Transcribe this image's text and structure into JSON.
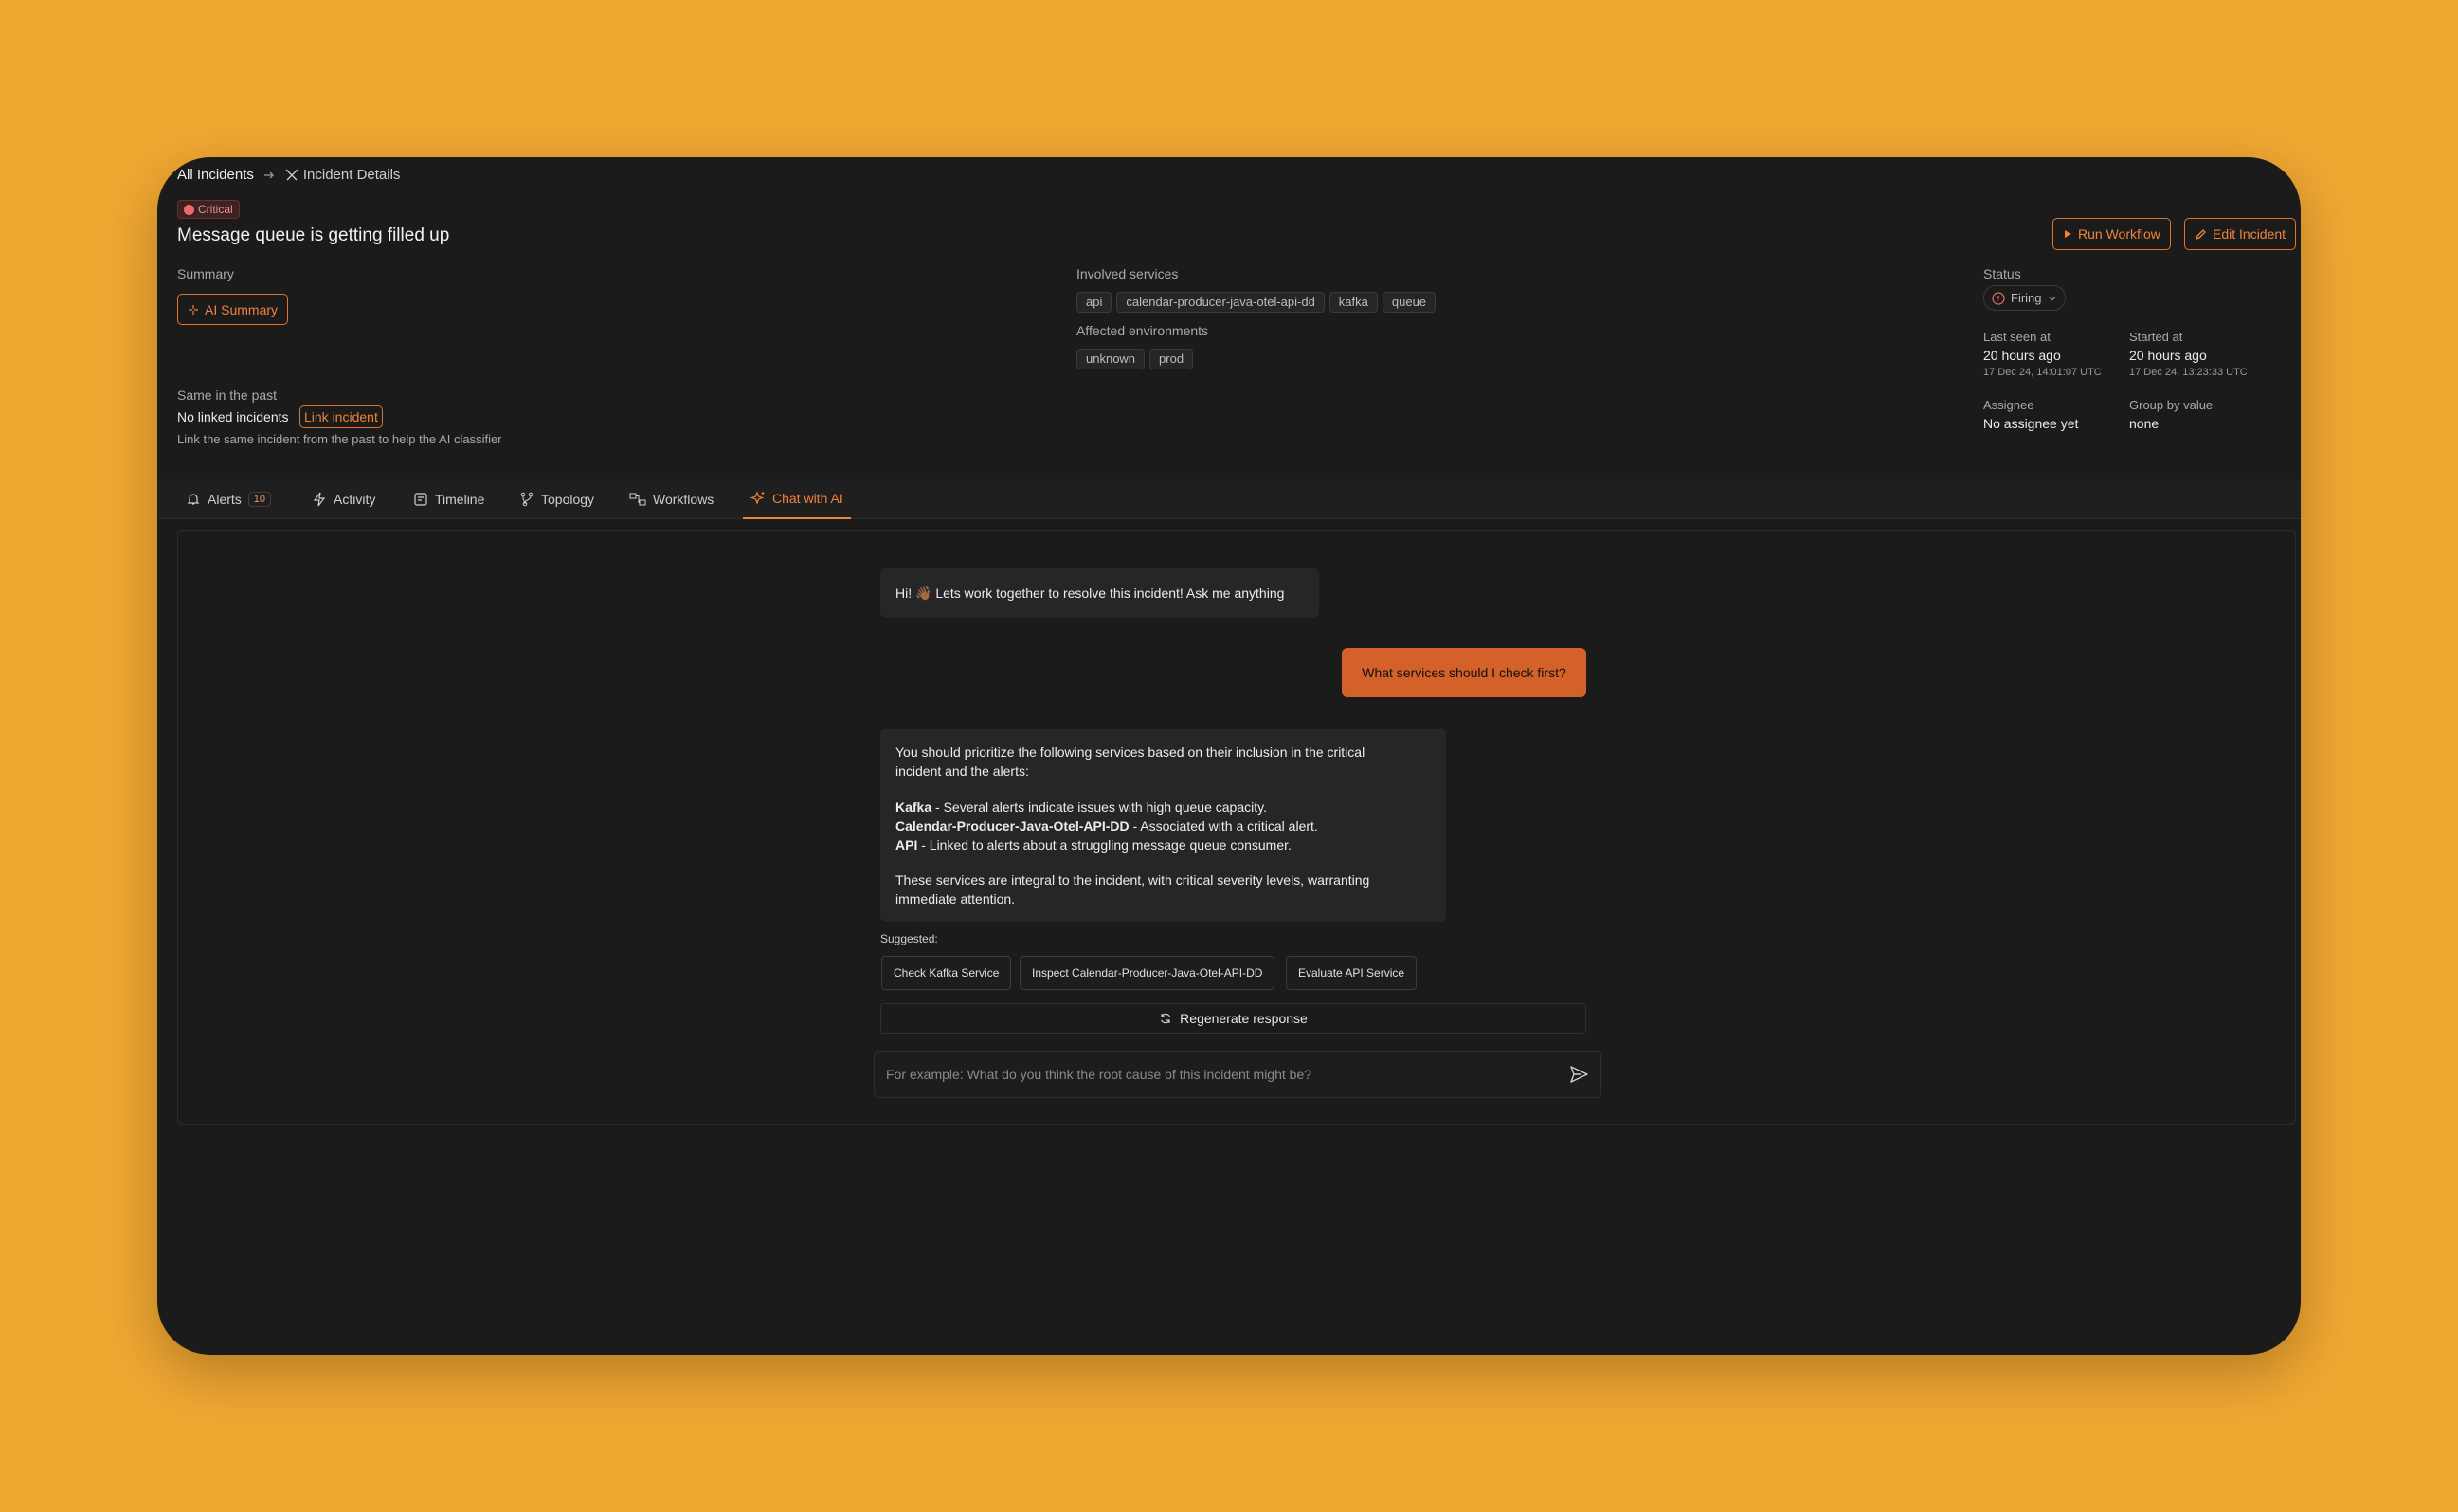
{
  "breadcrumb": {
    "root": "All Incidents",
    "current": "Incident Details"
  },
  "incident": {
    "severity": "Critical",
    "title": "Message queue is getting filled up"
  },
  "actions": {
    "run_workflow": "Run Workflow",
    "edit_incident": "Edit Incident"
  },
  "summary": {
    "label": "Summary",
    "ai_button": "AI Summary"
  },
  "involved_services": {
    "label": "Involved services",
    "items": [
      "api",
      "calendar-producer-java-otel-api-dd",
      "kafka",
      "queue"
    ]
  },
  "environments": {
    "label": "Affected environments",
    "items": [
      "unknown",
      "prod"
    ]
  },
  "status": {
    "label": "Status",
    "value": "Firing"
  },
  "last_seen": {
    "label": "Last seen at",
    "relative": "20 hours ago",
    "absolute": "17 Dec 24, 14:01:07 UTC"
  },
  "started": {
    "label": "Started at",
    "relative": "20 hours ago",
    "absolute": "17 Dec 24, 13:23:33 UTC"
  },
  "assignee": {
    "label": "Assignee",
    "value": "No assignee yet"
  },
  "group_by": {
    "label": "Group by value",
    "value": "none"
  },
  "past": {
    "label": "Same in the past",
    "value": "No linked incidents",
    "link_button": "Link incident",
    "hint": "Link the same incident from the past to help the AI classifier"
  },
  "tabs": [
    {
      "label": "Alerts",
      "count": "10",
      "icon": "bell-icon"
    },
    {
      "label": "Activity",
      "icon": "bolt-icon"
    },
    {
      "label": "Timeline",
      "icon": "timeline-icon"
    },
    {
      "label": "Topology",
      "icon": "topology-icon"
    },
    {
      "label": "Workflows",
      "icon": "workflow-icon"
    },
    {
      "label": "Chat with AI",
      "icon": "sparkles-icon",
      "active": true
    }
  ],
  "chat": {
    "greeting": "Hi! 👋🏾 Lets work together to resolve this incident! Ask me anything",
    "user_message": "What services should I check first?",
    "response": {
      "intro_line1": "You should prioritize the following services based on their inclusion in the critical",
      "intro_line2": "incident and the alerts:",
      "items": [
        {
          "name": "Kafka",
          "text": " - Several alerts indicate issues with high queue capacity."
        },
        {
          "name": "Calendar-Producer-Java-Otel-API-DD",
          "text": " - Associated with a critical alert."
        },
        {
          "name": "API",
          "text": " - Linked to alerts about a struggling message queue consumer."
        }
      ],
      "outro_line1": "These services are integral to the incident, with critical severity levels, warranting",
      "outro_line2": "immediate attention."
    },
    "suggested_label": "Suggested:",
    "suggestions": [
      "Check Kafka Service",
      "Inspect Calendar-Producer-Java-Otel-API-DD",
      "Evaluate API Service"
    ],
    "regenerate": "Regenerate response",
    "input_placeholder": "For example: What do you think the root cause of this incident might be?"
  },
  "colors": {
    "background": "#f0a732",
    "window": "#1b1b1b",
    "accent": "#f0833a",
    "user_bubble": "#d4602a",
    "critical": "#ef6b6b"
  }
}
